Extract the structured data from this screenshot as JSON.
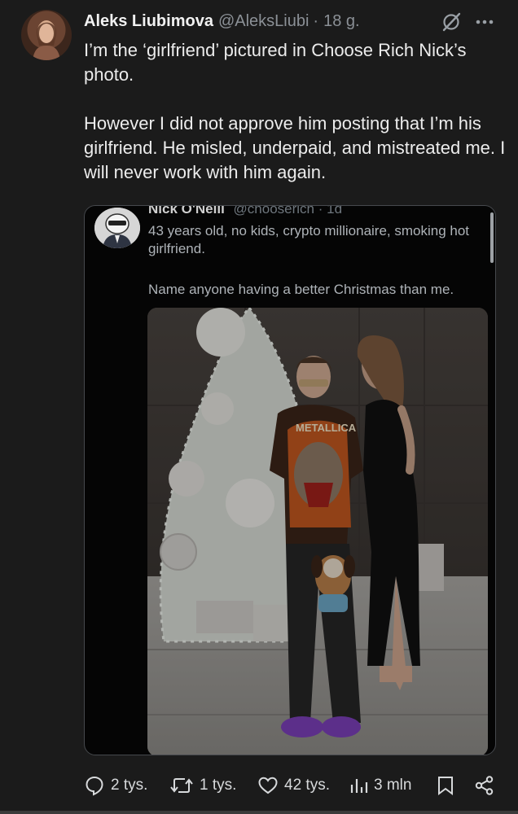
{
  "tweet": {
    "author_name": "Aleks Liubimova",
    "author_handle": "@AleksLiubi",
    "separator": "·",
    "time": "18 g.",
    "text": "I’m the ‘girlfriend’ pictured in Choose Rich Nick’s photo.\n\nHowever I did not approve him posting that I’m his girlfriend. He misled, underpaid, and mistreated me. I will never work with him again."
  },
  "embedded": {
    "author_name": "Nick O'Neill",
    "author_handle": "@chooserich · 1d",
    "text_1": "43 years old, no kids, crypto millionaire, smoking hot girlfriend.",
    "text_2": "Name anyone having a better Christmas than me.",
    "photo_shirt_text": "METALLICA"
  },
  "actions": {
    "replies": "2 tys.",
    "reposts": "1 tys.",
    "likes": "42 tys.",
    "views": "3 mln"
  },
  "icons": {
    "grok": "grok-icon",
    "more": "more-icon",
    "reply": "reply-icon",
    "repost": "repost-icon",
    "like": "heart-icon",
    "views": "views-icon",
    "bookmark": "bookmark-icon",
    "share": "share-icon"
  }
}
